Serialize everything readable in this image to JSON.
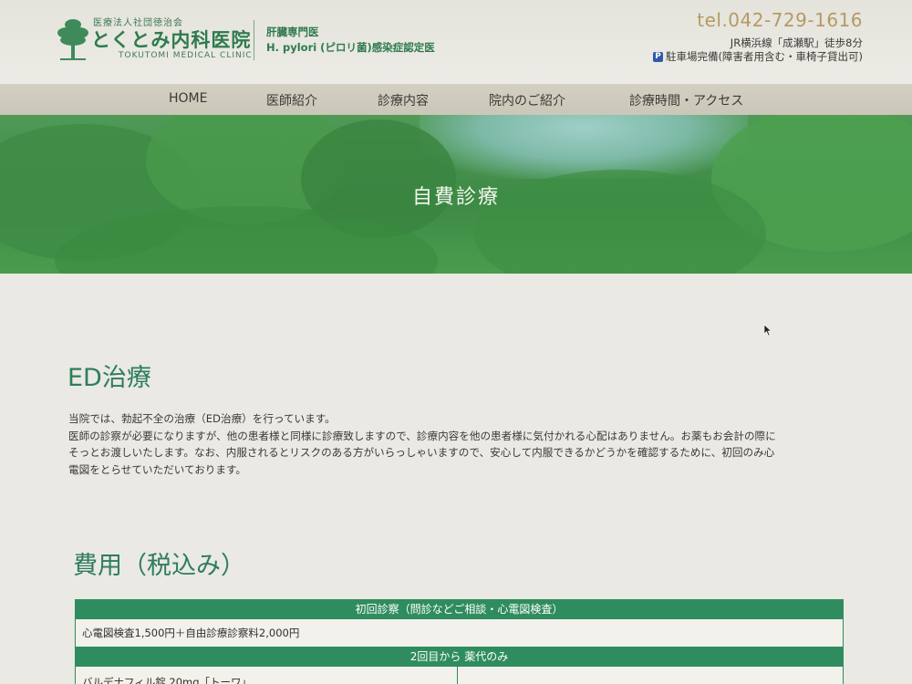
{
  "header": {
    "logo_sub": "医療法人社団徳治会",
    "logo_main": "とくとみ内科医院",
    "logo_en": "TOKUTOMI MEDICAL CLINIC",
    "spec_line1": "肝臓専門医",
    "spec_line2": "H. pylori (ピロリ菌)感染症認定医",
    "tel": "tel.042-729-1616",
    "access": "JR横浜線「成瀬駅」徒歩8分",
    "parking_icon": "P",
    "parking": "駐車場完備(障害者用含む・車椅子貸出可)"
  },
  "nav": {
    "items": [
      "HOME",
      "医師紹介",
      "診療内容",
      "院内のご紹介",
      "診療時間・アクセス"
    ]
  },
  "hero": {
    "title": "自費診療"
  },
  "main": {
    "section_title": "ED治療",
    "paragraphs": [
      "当院では、勃起不全の治療（ED治療）を行っています。",
      "医師の診察が必要になりますが、他の患者様と同様に診療致しますので、診療内容を他の患者様に気付かれる心配はありません。お薬もお会計の際に",
      "そっとお渡しいたします。なお、内服されるとリスクのある方がいらっしゃいますので、安心して内服できるかどうかを確認するために、初回のみ心",
      "電図をとらせていただいております。"
    ],
    "fee_title": "費用（税込み）",
    "table": {
      "head1": "初回診察（問診などご相談・心電図検査）",
      "row1": "心電図検査1,500円＋自由診療診察料2,000円",
      "head2": "2回目から 薬代のみ",
      "row2_left": "バルデナフィル錠 20mg「トーワ」"
    }
  },
  "colors": {
    "accent_green": "#2f8c5e",
    "title_green": "#2e7d5c",
    "tel_gold": "#b59a62"
  }
}
